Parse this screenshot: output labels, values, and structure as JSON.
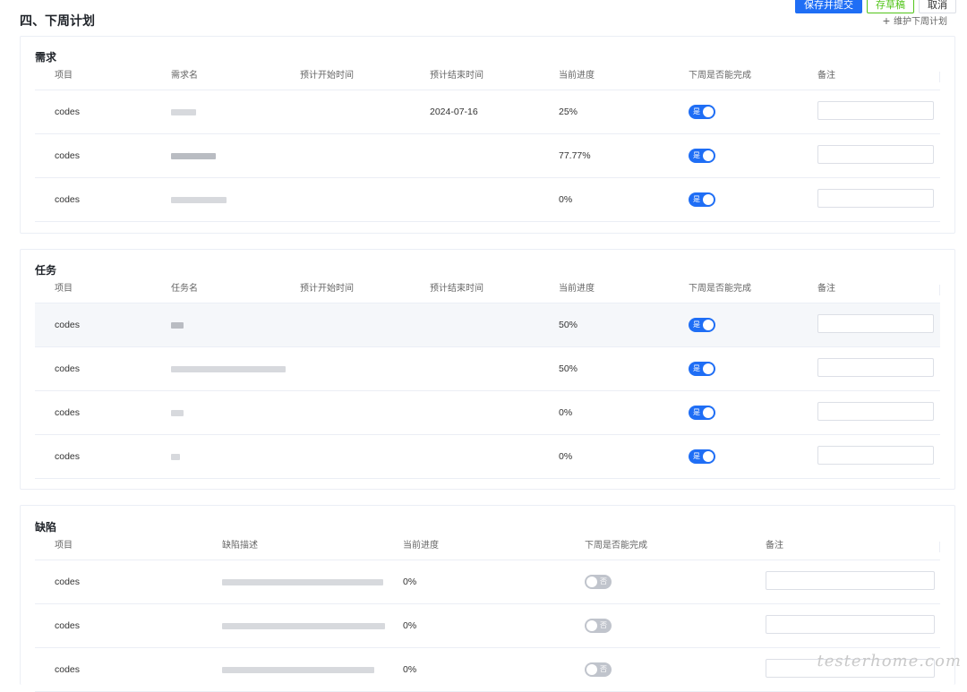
{
  "header": {
    "section_title": "四、下周计划",
    "buttons": {
      "submit": "保存并提交",
      "draft": "存草稿",
      "cancel": "取消"
    },
    "maintain_link": "维护下周计划"
  },
  "requirements": {
    "title": "需求",
    "columns": [
      "项目",
      "需求名",
      "预计开始时间",
      "预计结束时间",
      "当前进度",
      "下周是否能完成",
      "备注"
    ],
    "rows": [
      {
        "project": "codes",
        "name": "",
        "start": "",
        "end": "2024-07-16",
        "progress": "25%",
        "can_finish": "是",
        "note": ""
      },
      {
        "project": "codes",
        "name": "",
        "start": "",
        "end": "",
        "progress": "77.77%",
        "can_finish": "是",
        "note": ""
      },
      {
        "project": "codes",
        "name": "",
        "start": "",
        "end": "",
        "progress": "0%",
        "can_finish": "是",
        "note": ""
      }
    ]
  },
  "tasks": {
    "title": "任务",
    "columns": [
      "项目",
      "任务名",
      "预计开始时间",
      "预计结束时间",
      "当前进度",
      "下周是否能完成",
      "备注"
    ],
    "rows": [
      {
        "project": "codes",
        "name": "",
        "progress": "50%",
        "can_finish": "是",
        "note": ""
      },
      {
        "project": "codes",
        "name": "",
        "progress": "50%",
        "can_finish": "是",
        "note": ""
      },
      {
        "project": "codes",
        "name": "",
        "progress": "0%",
        "can_finish": "是",
        "note": ""
      },
      {
        "project": "codes",
        "name": "",
        "progress": "0%",
        "can_finish": "是",
        "note": ""
      }
    ]
  },
  "defects": {
    "title": "缺陷",
    "columns": [
      "项目",
      "缺陷描述",
      "当前进度",
      "下周是否能完成",
      "备注"
    ],
    "rows": [
      {
        "project": "codes",
        "desc": "",
        "progress": "0%",
        "can_finish": "否",
        "note": ""
      },
      {
        "project": "codes",
        "desc": "",
        "progress": "0%",
        "can_finish": "否",
        "note": ""
      },
      {
        "project": "codes",
        "desc": "",
        "progress": "0%",
        "can_finish": "否",
        "note": ""
      }
    ]
  },
  "watermark": "testerhome.com",
  "colors": {
    "primary": "#1f6ef5",
    "success": "#52c41a",
    "switch_off": "#c0c4cc"
  }
}
